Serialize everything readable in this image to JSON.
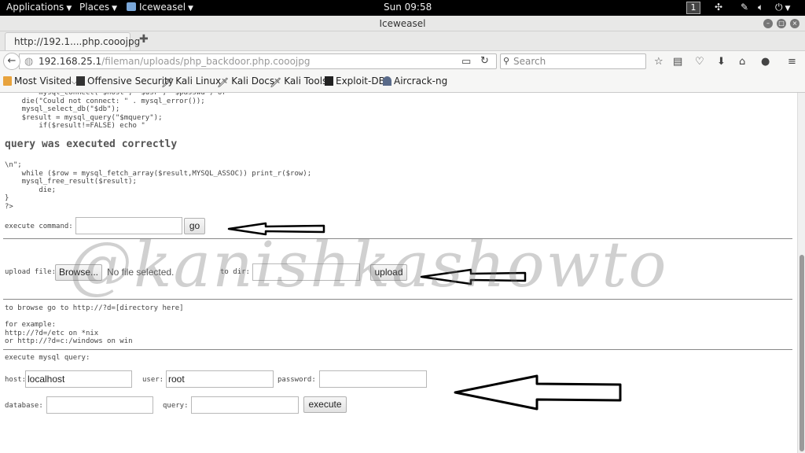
{
  "topbar": {
    "applications": "Applications",
    "places": "Places",
    "app_menu": "Iceweasel",
    "clock": "Sun 09:58",
    "workspace": "1"
  },
  "window": {
    "title": "Iceweasel"
  },
  "tab": {
    "title": "http://192.1....php.cooojpg"
  },
  "navbar": {
    "url_host": "192.168.25.1",
    "url_path": "/fileman/uploads/php_backdoor.php.cooojpg",
    "search_placeholder": "Search"
  },
  "bookmarks": [
    {
      "label": "Most Visited",
      "icon": "folder-icon"
    },
    {
      "label": "Offensive Security",
      "icon": "offsec-icon"
    },
    {
      "label": "Kali Linux",
      "icon": "kali-icon"
    },
    {
      "label": "Kali Docs",
      "icon": "kali-icon"
    },
    {
      "label": "Kali Tools",
      "icon": "kali-icon"
    },
    {
      "label": "Exploit-DB",
      "icon": "exploitdb-icon"
    },
    {
      "label": "Aircrack-ng",
      "icon": "aircrack-icon"
    }
  ],
  "content": {
    "code_top": "        mysql_connect(\"$host\", \"$usr\", \"$passwd\") or\n    die(\"Could not connect: \" . mysql_error());\n    mysql_select_db(\"$db\");\n    $result = mysql_query(\"$mquery\");\n        if($result!=FALSE) echo \"",
    "heading": "query was executed correctly",
    "code_bottom": "\\n\";\n    while ($row = mysql_fetch_array($result,MYSQL_ASSOC)) print_r($row);\n    mysql_free_result($result);\n        die;\n}\n?>",
    "execute_command_label": "execute command:",
    "go_button": "go",
    "upload_file_label": "upload file:",
    "browse_button": "Browse...",
    "no_file": "No file selected.",
    "to_dir_label": "to dir:",
    "upload_button": "upload",
    "browse_help": "to browse go to http://?d=[directory here]\n\nfor example:\nhttp://?d=/etc on *nix\nor http://?d=c:/windows on win",
    "mysql_label": "execute mysql query:",
    "host_label": "host:",
    "host_value": "localhost",
    "user_label": "user:",
    "user_value": "root",
    "password_label": "password:",
    "database_label": "database:",
    "query_label": "query:",
    "execute_button": "execute",
    "watermark": "@kanishkashowto"
  },
  "colors": {
    "topbar_bg": "#000000",
    "chrome_bg": "#e8e8e7",
    "arrow": "#000000"
  }
}
